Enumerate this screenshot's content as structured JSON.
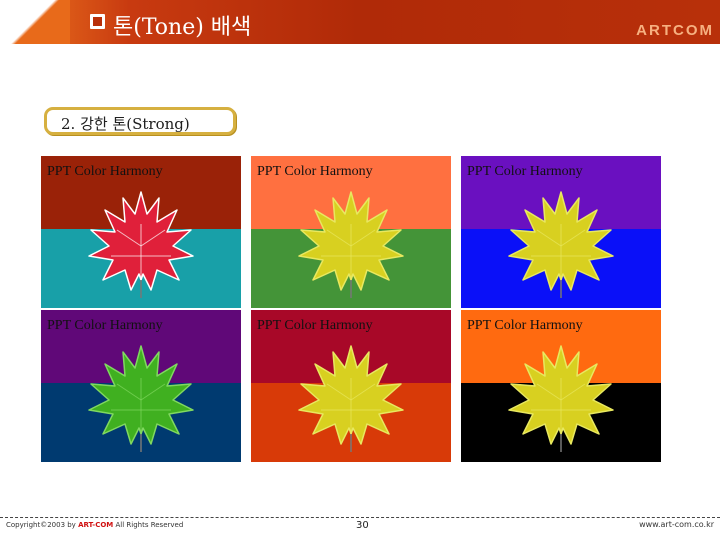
{
  "header": {
    "title": "톤(Tone) 배색",
    "brand": "ARTCOM",
    "bullet_icon": "square-bullet-icon"
  },
  "section": {
    "label": "2. 강한 톤(Strong)"
  },
  "tiles": [
    {
      "caption": "PPT Color Harmony",
      "top_color": "#9a2208",
      "bottom_color": "#18a0a8",
      "leaf_color": "#e0203a",
      "leaf_edge": "#ffffff"
    },
    {
      "caption": "PPT Color Harmony",
      "top_color": "#ff7040",
      "bottom_color": "#449438",
      "leaf_color": "#d8d020",
      "leaf_edge": "#e8e860"
    },
    {
      "caption": "PPT Color Harmony",
      "top_color": "#6a10c0",
      "bottom_color": "#0a10f8",
      "leaf_color": "#d8d020",
      "leaf_edge": "#e8e860"
    },
    {
      "caption": "PPT Color Harmony",
      "top_color": "#600878",
      "bottom_color": "#003a70",
      "leaf_color": "#40b020",
      "leaf_edge": "#80d860"
    },
    {
      "caption": "PPT Color Harmony",
      "top_color": "#a80828",
      "bottom_color": "#d83a08",
      "leaf_color": "#d8d020",
      "leaf_edge": "#e8e860"
    },
    {
      "caption": "PPT Color Harmony",
      "top_color": "#ff6a10",
      "bottom_color": "#000000",
      "leaf_color": "#d8d020",
      "leaf_edge": "#e8e860"
    }
  ],
  "footer": {
    "copyright_prefix": "Copyright©2003 by ",
    "copyright_brand": "ART-COM",
    "copyright_suffix": " All Rights Reserved",
    "page_number": "30",
    "url": "www.art-com.co.kr"
  }
}
